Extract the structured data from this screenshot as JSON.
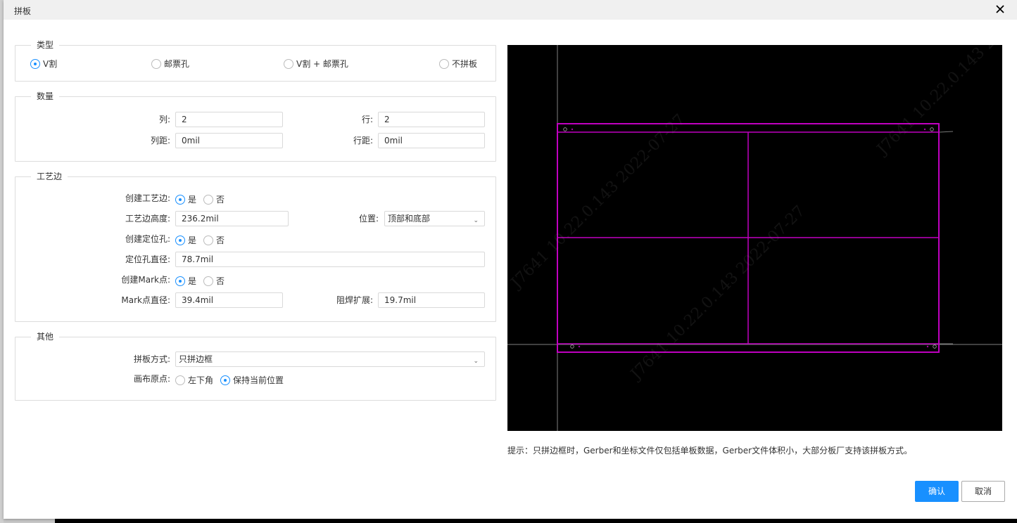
{
  "dialog": {
    "title": "拼板",
    "close_icon": "close-icon"
  },
  "type_group": {
    "legend": "类型",
    "options": [
      {
        "label": "V割",
        "checked": true
      },
      {
        "label": "邮票孔",
        "checked": false
      },
      {
        "label": "V割 + 邮票孔",
        "checked": false
      },
      {
        "label": "不拼板",
        "checked": false
      }
    ]
  },
  "quantity_group": {
    "legend": "数量",
    "columns_label": "列:",
    "columns_value": "2",
    "rows_label": "行:",
    "rows_value": "2",
    "col_spacing_label": "列距:",
    "col_spacing_value": "0mil",
    "row_spacing_label": "行距:",
    "row_spacing_value": "0mil"
  },
  "rail_group": {
    "legend": "工艺边",
    "create_rail_label": "创建工艺边:",
    "create_rail_yes": "是",
    "create_rail_no": "否",
    "create_rail_value": "是",
    "rail_height_label": "工艺边高度:",
    "rail_height_value": "236.2mil",
    "position_label": "位置:",
    "position_value": "顶部和底部",
    "create_hole_label": "创建定位孔:",
    "create_hole_yes": "是",
    "create_hole_no": "否",
    "create_hole_value": "是",
    "hole_diameter_label": "定位孔直径:",
    "hole_diameter_value": "78.7mil",
    "create_mark_label": "创建Mark点:",
    "create_mark_yes": "是",
    "create_mark_no": "否",
    "create_mark_value": "是",
    "mark_diameter_label": "Mark点直径:",
    "mark_diameter_value": "39.4mil",
    "solder_mask_label": "阻焊扩展:",
    "solder_mask_value": "19.7mil"
  },
  "other_group": {
    "legend": "其他",
    "panel_mode_label": "拼板方式:",
    "panel_mode_value": "只拼边框",
    "origin_label": "画布原点:",
    "origin_option_1": "左下角",
    "origin_option_2": "保持当前位置",
    "origin_value": "保持当前位置"
  },
  "preview": {
    "background": "#000000",
    "outline_color": "#c000c0",
    "axis_color": "#808080",
    "columns": 2,
    "rows": 2,
    "watermark": "J7641 10.22.0.143 2022-07-27"
  },
  "hint": "提示：只拼边框时，Gerber和坐标文件仅包括单板数据，Gerber文件体积小，大部分板厂支持该拼板方式。",
  "buttons": {
    "confirm": "确认",
    "cancel": "取消"
  },
  "colors": {
    "accent": "#1890ff"
  }
}
